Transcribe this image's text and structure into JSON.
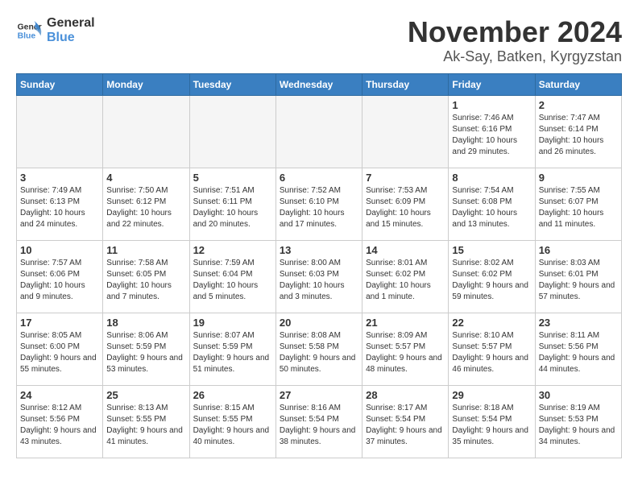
{
  "logo": {
    "general": "General",
    "blue": "Blue"
  },
  "header": {
    "month": "November 2024",
    "location": "Ak-Say, Batken, Kyrgyzstan"
  },
  "weekdays": [
    "Sunday",
    "Monday",
    "Tuesday",
    "Wednesday",
    "Thursday",
    "Friday",
    "Saturday"
  ],
  "weeks": [
    [
      {
        "day": "",
        "info": ""
      },
      {
        "day": "",
        "info": ""
      },
      {
        "day": "",
        "info": ""
      },
      {
        "day": "",
        "info": ""
      },
      {
        "day": "",
        "info": ""
      },
      {
        "day": "1",
        "info": "Sunrise: 7:46 AM\nSunset: 6:16 PM\nDaylight: 10 hours and 29 minutes."
      },
      {
        "day": "2",
        "info": "Sunrise: 7:47 AM\nSunset: 6:14 PM\nDaylight: 10 hours and 26 minutes."
      }
    ],
    [
      {
        "day": "3",
        "info": "Sunrise: 7:49 AM\nSunset: 6:13 PM\nDaylight: 10 hours and 24 minutes."
      },
      {
        "day": "4",
        "info": "Sunrise: 7:50 AM\nSunset: 6:12 PM\nDaylight: 10 hours and 22 minutes."
      },
      {
        "day": "5",
        "info": "Sunrise: 7:51 AM\nSunset: 6:11 PM\nDaylight: 10 hours and 20 minutes."
      },
      {
        "day": "6",
        "info": "Sunrise: 7:52 AM\nSunset: 6:10 PM\nDaylight: 10 hours and 17 minutes."
      },
      {
        "day": "7",
        "info": "Sunrise: 7:53 AM\nSunset: 6:09 PM\nDaylight: 10 hours and 15 minutes."
      },
      {
        "day": "8",
        "info": "Sunrise: 7:54 AM\nSunset: 6:08 PM\nDaylight: 10 hours and 13 minutes."
      },
      {
        "day": "9",
        "info": "Sunrise: 7:55 AM\nSunset: 6:07 PM\nDaylight: 10 hours and 11 minutes."
      }
    ],
    [
      {
        "day": "10",
        "info": "Sunrise: 7:57 AM\nSunset: 6:06 PM\nDaylight: 10 hours and 9 minutes."
      },
      {
        "day": "11",
        "info": "Sunrise: 7:58 AM\nSunset: 6:05 PM\nDaylight: 10 hours and 7 minutes."
      },
      {
        "day": "12",
        "info": "Sunrise: 7:59 AM\nSunset: 6:04 PM\nDaylight: 10 hours and 5 minutes."
      },
      {
        "day": "13",
        "info": "Sunrise: 8:00 AM\nSunset: 6:03 PM\nDaylight: 10 hours and 3 minutes."
      },
      {
        "day": "14",
        "info": "Sunrise: 8:01 AM\nSunset: 6:02 PM\nDaylight: 10 hours and 1 minute."
      },
      {
        "day": "15",
        "info": "Sunrise: 8:02 AM\nSunset: 6:02 PM\nDaylight: 9 hours and 59 minutes."
      },
      {
        "day": "16",
        "info": "Sunrise: 8:03 AM\nSunset: 6:01 PM\nDaylight: 9 hours and 57 minutes."
      }
    ],
    [
      {
        "day": "17",
        "info": "Sunrise: 8:05 AM\nSunset: 6:00 PM\nDaylight: 9 hours and 55 minutes."
      },
      {
        "day": "18",
        "info": "Sunrise: 8:06 AM\nSunset: 5:59 PM\nDaylight: 9 hours and 53 minutes."
      },
      {
        "day": "19",
        "info": "Sunrise: 8:07 AM\nSunset: 5:59 PM\nDaylight: 9 hours and 51 minutes."
      },
      {
        "day": "20",
        "info": "Sunrise: 8:08 AM\nSunset: 5:58 PM\nDaylight: 9 hours and 50 minutes."
      },
      {
        "day": "21",
        "info": "Sunrise: 8:09 AM\nSunset: 5:57 PM\nDaylight: 9 hours and 48 minutes."
      },
      {
        "day": "22",
        "info": "Sunrise: 8:10 AM\nSunset: 5:57 PM\nDaylight: 9 hours and 46 minutes."
      },
      {
        "day": "23",
        "info": "Sunrise: 8:11 AM\nSunset: 5:56 PM\nDaylight: 9 hours and 44 minutes."
      }
    ],
    [
      {
        "day": "24",
        "info": "Sunrise: 8:12 AM\nSunset: 5:56 PM\nDaylight: 9 hours and 43 minutes."
      },
      {
        "day": "25",
        "info": "Sunrise: 8:13 AM\nSunset: 5:55 PM\nDaylight: 9 hours and 41 minutes."
      },
      {
        "day": "26",
        "info": "Sunrise: 8:15 AM\nSunset: 5:55 PM\nDaylight: 9 hours and 40 minutes."
      },
      {
        "day": "27",
        "info": "Sunrise: 8:16 AM\nSunset: 5:54 PM\nDaylight: 9 hours and 38 minutes."
      },
      {
        "day": "28",
        "info": "Sunrise: 8:17 AM\nSunset: 5:54 PM\nDaylight: 9 hours and 37 minutes."
      },
      {
        "day": "29",
        "info": "Sunrise: 8:18 AM\nSunset: 5:54 PM\nDaylight: 9 hours and 35 minutes."
      },
      {
        "day": "30",
        "info": "Sunrise: 8:19 AM\nSunset: 5:53 PM\nDaylight: 9 hours and 34 minutes."
      }
    ]
  ]
}
